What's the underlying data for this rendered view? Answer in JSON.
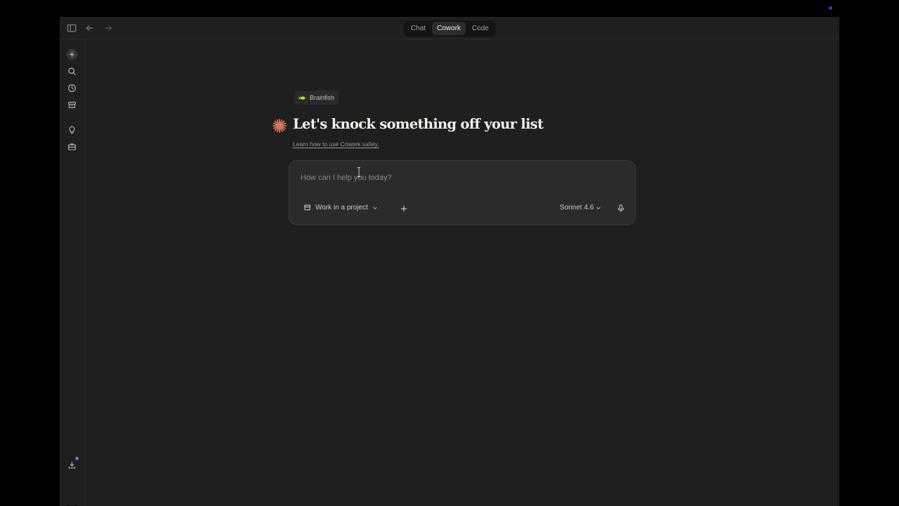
{
  "modes": [
    {
      "label": "Chat",
      "active": false
    },
    {
      "label": "Cowork",
      "active": true
    },
    {
      "label": "Code",
      "active": false
    }
  ],
  "org": {
    "name": "Brainfish"
  },
  "heading": "Let's knock something off your list",
  "learn_link": "Learn how to use Cowork safely.",
  "composer": {
    "placeholder": "How can I help you today?",
    "project_label": "Work in a project",
    "model_label": "Sonnet 4.6"
  },
  "sidebar_icons": [
    "plus-icon",
    "search-icon",
    "clock-icon",
    "archive-icon",
    "lightbulb-icon",
    "briefcase-icon",
    "download-icon"
  ],
  "colors": {
    "accent_spark": "#d9775a",
    "brand_fish": "#b5ef2a",
    "notification_dot": "#4a7cf5"
  }
}
